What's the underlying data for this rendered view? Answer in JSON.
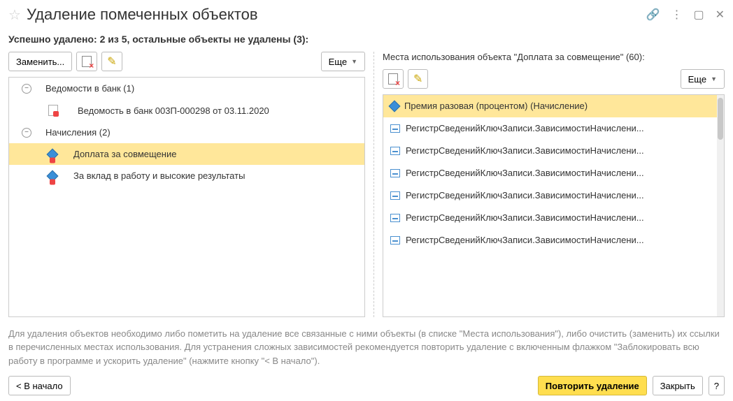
{
  "titlebar": {
    "title": "Удаление помеченных объектов"
  },
  "status": "Успешно удалено: 2 из 5, остальные объекты не удалены (3):",
  "left": {
    "toolbar": {
      "replace_label": "Заменить...",
      "more_label": "Еще"
    },
    "tree": {
      "group1": {
        "label": "Ведомости в банк (1)"
      },
      "group1_item1": {
        "label": "Ведомость в банк 003П-000298 от 03.11.2020"
      },
      "group2": {
        "label": "Начисления (2)"
      },
      "group2_item1": {
        "label": "Доплата за совмещение"
      },
      "group2_item2": {
        "label": "За вклад в работу и высокие результаты"
      }
    }
  },
  "right": {
    "header": "Места использования объекта \"Доплата за совмещение\" (60):",
    "more_label": "Еще",
    "items": [
      "Премия разовая (процентом) (Начисление)",
      "РегистрСведенийКлючЗаписи.ЗависимостиНачислени...",
      "РегистрСведенийКлючЗаписи.ЗависимостиНачислени...",
      "РегистрСведенийКлючЗаписи.ЗависимостиНачислени...",
      "РегистрСведенийКлючЗаписи.ЗависимостиНачислени...",
      "РегистрСведенийКлючЗаписи.ЗависимостиНачислени...",
      "РегистрСведенийКлючЗаписи.ЗависимостиНачислени..."
    ]
  },
  "hint": "Для удаления объектов необходимо либо пометить на удаление все связанные с ними объекты (в списке \"Места использования\"), либо очистить (заменить) их ссылки в перечисленных местах использования. Для устранения сложных зависимостей рекомендуется повторить удаление с включенным флажком \"Заблокировать всю работу в программе и ускорить удаление\" (нажмите кнопку \"< В начало\").",
  "footer": {
    "back_label": "< В начало",
    "retry_label": "Повторить удаление",
    "close_label": "Закрыть",
    "help_label": "?"
  }
}
